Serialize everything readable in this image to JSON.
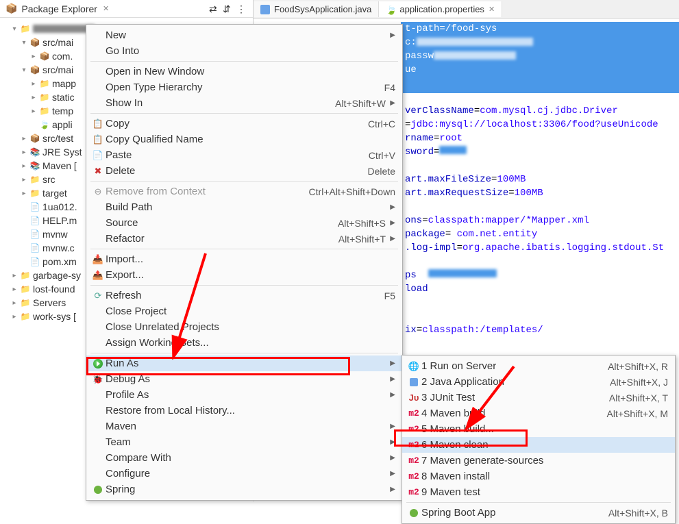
{
  "explorer": {
    "title": "Package Explorer",
    "tree": {
      "project_blur": true,
      "srcMainJava": "src/mai",
      "pkg1": "com.",
      "srcMainRes": "src/mai",
      "mappers": "mapp",
      "static_": "static",
      "templates": "temp",
      "appProps": "appli",
      "srcTest": "src/test",
      "jre": "JRE Syst",
      "mavenDeps": "Maven [",
      "src": "src",
      "target": "target",
      "lua": "1ua012.",
      "help": "HELP.m",
      "mvnw": "mvnw",
      "mvnwc": "mvnw.c",
      "pom": "pom.xm",
      "garbage": "garbage-sy",
      "lost": "lost-found",
      "servers": "Servers",
      "work": "work-sys ["
    }
  },
  "tabs": {
    "java": "FoodSysApplication.java",
    "props": "application.properties"
  },
  "editor": {
    "l1_key": "t-path",
    "l1_val": "/food-sys",
    "l2_key": "c:",
    "l3_key": "passw",
    "l4_key": "ue",
    "l5_key": "verClassName",
    "l5_val": "com.mysql.cj.jdbc.Driver",
    "l6_key": "",
    "l6_val": "jdbc:mysql://localhost:3306/food?useUnicode",
    "l7_key": "rname",
    "l7_val": "root",
    "l8_key": "sword",
    "l9_key": "art.maxFileSize",
    "l9_val": "100MB",
    "l10_key": "art.maxRequestSize",
    "l10_val": "100MB",
    "l11_key": "ons",
    "l11_val": "classpath:mapper/*Mapper.xml",
    "l12_key": "package",
    "l12_val": " com.net.entity",
    "l13_key": ".log-impl",
    "l13_val": "org.apache.ibatis.logging.stdout.St",
    "l14_key": "ps",
    "l15_key": "load",
    "l16_key": "ix",
    "l16_val": "classpath:/templates/"
  },
  "menu": {
    "new_": "New",
    "goInto": "Go Into",
    "openNewWin": "Open in New Window",
    "openTypeHier": "Open Type Hierarchy",
    "openTypeHier_sc": "F4",
    "showIn": "Show In",
    "showIn_sc": "Alt+Shift+W",
    "copy": "Copy",
    "copy_sc": "Ctrl+C",
    "copyQual": "Copy Qualified Name",
    "paste": "Paste",
    "paste_sc": "Ctrl+V",
    "delete": "Delete",
    "delete_sc": "Delete",
    "removeCtx": "Remove from Context",
    "removeCtx_sc": "Ctrl+Alt+Shift+Down",
    "buildPath": "Build Path",
    "source": "Source",
    "source_sc": "Alt+Shift+S",
    "refactor": "Refactor",
    "refactor_sc": "Alt+Shift+T",
    "import_": "Import...",
    "export_": "Export...",
    "refresh": "Refresh",
    "refresh_sc": "F5",
    "closeProj": "Close Project",
    "closeUnrel": "Close Unrelated Projects",
    "assignWS": "Assign Working Sets...",
    "runAs": "Run As",
    "debugAs": "Debug As",
    "profileAs": "Profile As",
    "restoreLH": "Restore from Local History...",
    "maven": "Maven",
    "team": "Team",
    "compareWith": "Compare With",
    "configure": "Configure",
    "spring": "Spring"
  },
  "submenu": {
    "i1": "1 Run on Server",
    "i1_sc": "Alt+Shift+X, R",
    "i2": "2 Java Application",
    "i2_sc": "Alt+Shift+X, J",
    "i3": "3 JUnit Test",
    "i3_sc": "Alt+Shift+X, T",
    "i4": "4 Maven build",
    "i4_sc": "Alt+Shift+X, M",
    "i5": "5 Maven build...",
    "i6": "6 Maven clean",
    "i7": "7 Maven generate-sources",
    "i8": "8 Maven install",
    "i9": "9 Maven test",
    "i10": "Spring Boot App",
    "i10_sc": "Alt+Shift+X, B"
  }
}
